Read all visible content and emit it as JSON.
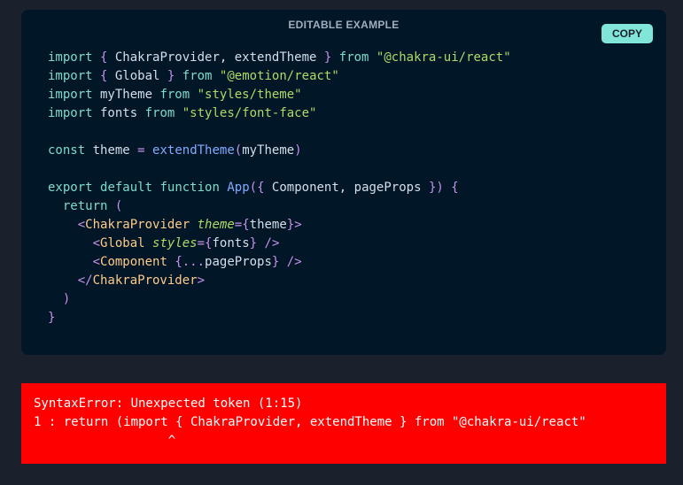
{
  "editor": {
    "label": "EDITABLE EXAMPLE",
    "copy_label": "COPY",
    "lines": [
      [
        [
          "kw",
          "import"
        ],
        [
          "id",
          " "
        ],
        [
          "punct",
          "{"
        ],
        [
          "id",
          " ChakraProvider, extendTheme "
        ],
        [
          "punct",
          "}"
        ],
        [
          "id",
          " "
        ],
        [
          "kw",
          "from"
        ],
        [
          "id",
          " "
        ],
        [
          "str",
          "\"@chakra-ui/react\""
        ]
      ],
      [
        [
          "kw",
          "import"
        ],
        [
          "id",
          " "
        ],
        [
          "punct",
          "{"
        ],
        [
          "id",
          " Global "
        ],
        [
          "punct",
          "}"
        ],
        [
          "id",
          " "
        ],
        [
          "kw",
          "from"
        ],
        [
          "id",
          " "
        ],
        [
          "str",
          "\"@emotion/react\""
        ]
      ],
      [
        [
          "kw",
          "import"
        ],
        [
          "id",
          " myTheme "
        ],
        [
          "kw",
          "from"
        ],
        [
          "id",
          " "
        ],
        [
          "str",
          "\"styles/theme\""
        ]
      ],
      [
        [
          "kw",
          "import"
        ],
        [
          "id",
          " fonts "
        ],
        [
          "kw",
          "from"
        ],
        [
          "id",
          " "
        ],
        [
          "str",
          "\"styles/font-face\""
        ]
      ],
      [],
      [
        [
          "kw",
          "const"
        ],
        [
          "id",
          " theme "
        ],
        [
          "kw2",
          "="
        ],
        [
          "id",
          " "
        ],
        [
          "fn",
          "extendTheme"
        ],
        [
          "punct",
          "("
        ],
        [
          "id",
          "myTheme"
        ],
        [
          "punct",
          ")"
        ]
      ],
      [],
      [
        [
          "kw",
          "export"
        ],
        [
          "id",
          " "
        ],
        [
          "kw",
          "default"
        ],
        [
          "id",
          " "
        ],
        [
          "kw",
          "function"
        ],
        [
          "id",
          " "
        ],
        [
          "fn",
          "App"
        ],
        [
          "punct",
          "({"
        ],
        [
          "id",
          " Component, pageProps "
        ],
        [
          "punct",
          "})"
        ],
        [
          "id",
          " "
        ],
        [
          "punct",
          "{"
        ]
      ],
      [
        [
          "id",
          "  "
        ],
        [
          "kw",
          "return"
        ],
        [
          "id",
          " "
        ],
        [
          "punct",
          "("
        ]
      ],
      [
        [
          "id",
          "    "
        ],
        [
          "punct",
          "<"
        ],
        [
          "tag",
          "ChakraProvider"
        ],
        [
          "id",
          " "
        ],
        [
          "attr",
          "theme"
        ],
        [
          "kw2",
          "="
        ],
        [
          "punct",
          "{"
        ],
        [
          "id",
          "theme"
        ],
        [
          "punct",
          "}"
        ],
        [
          "punct",
          ">"
        ]
      ],
      [
        [
          "id",
          "      "
        ],
        [
          "punct",
          "<"
        ],
        [
          "tag",
          "Global"
        ],
        [
          "id",
          " "
        ],
        [
          "attr",
          "styles"
        ],
        [
          "kw2",
          "="
        ],
        [
          "punct",
          "{"
        ],
        [
          "id",
          "fonts"
        ],
        [
          "punct",
          "}"
        ],
        [
          "id",
          " "
        ],
        [
          "punct",
          "/>"
        ]
      ],
      [
        [
          "id",
          "      "
        ],
        [
          "punct",
          "<"
        ],
        [
          "tag",
          "Component"
        ],
        [
          "id",
          " "
        ],
        [
          "punct",
          "{"
        ],
        [
          "kw2",
          "..."
        ],
        [
          "id",
          "pageProps"
        ],
        [
          "punct",
          "}"
        ],
        [
          "id",
          " "
        ],
        [
          "punct",
          "/>"
        ]
      ],
      [
        [
          "id",
          "    "
        ],
        [
          "punct",
          "</"
        ],
        [
          "tag",
          "ChakraProvider"
        ],
        [
          "punct",
          ">"
        ]
      ],
      [
        [
          "id",
          "  "
        ],
        [
          "punct",
          ")"
        ]
      ],
      [
        [
          "punct",
          "}"
        ]
      ]
    ]
  },
  "error": {
    "lines": [
      "SyntaxError: Unexpected token (1:15)",
      "1 : return (import { ChakraProvider, extendTheme } from \"@chakra-ui/react\"",
      "                  ^"
    ]
  },
  "colors": {
    "page_background": "#1a202c",
    "editor_background": "#011627",
    "copy_button": "#81e6d9",
    "error_background": "#ff0000"
  }
}
